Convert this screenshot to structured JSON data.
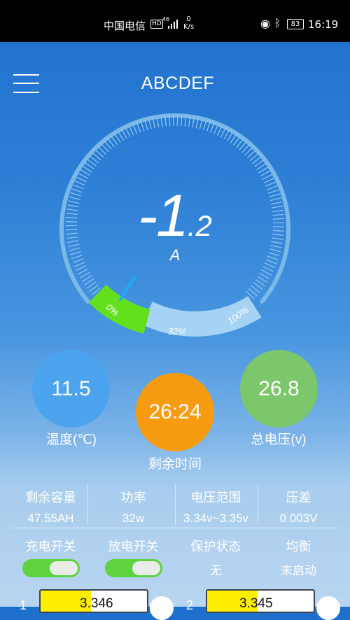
{
  "status_bar": {
    "carrier": "中国电信",
    "hd": "HD",
    "signal_label": "46",
    "speed_value": "0",
    "speed_unit": "K/s",
    "battery": "83",
    "time": "16:19"
  },
  "header": {
    "title": "ABCDEF"
  },
  "gauge": {
    "value_main": "-1",
    "value_decimal": ".2",
    "unit": "A",
    "label_start": "0%",
    "label_mid": "32%",
    "label_end": "100%",
    "percent": 32,
    "colors": {
      "ring": "#7ab8e6",
      "fill_low": "#63e01c",
      "fill_rest": "#a6d3f4",
      "needle": "#20a8ff"
    }
  },
  "stats": {
    "temperature": {
      "value": "11.5",
      "label": "温度(℃)",
      "color": "#4ca4ef"
    },
    "remaining_time": {
      "value": "26:24",
      "label": "剩余时间",
      "color": "#f79b10"
    },
    "total_voltage": {
      "value": "26.8",
      "label": "总电压(v)",
      "color": "#7cc66b"
    }
  },
  "info": {
    "remaining_capacity": {
      "title": "剩余容量",
      "value": "47.55AH"
    },
    "power": {
      "title": "功率",
      "value": "32w"
    },
    "voltage_range": {
      "title": "电压范围",
      "value": "3.34v~3.35v"
    },
    "voltage_diff": {
      "title": "压差",
      "value": "0.003V"
    }
  },
  "controls": {
    "charge_switch": {
      "title": "充电开关",
      "on": true
    },
    "discharge_switch": {
      "title": "放电开关",
      "on": true
    },
    "protection": {
      "title": "保护状态",
      "value": "无"
    },
    "balance": {
      "title": "均衡",
      "value": "未启动"
    }
  },
  "cells": [
    {
      "index": "1",
      "value": "3.346"
    },
    {
      "index": "2",
      "value": "3.345"
    }
  ]
}
